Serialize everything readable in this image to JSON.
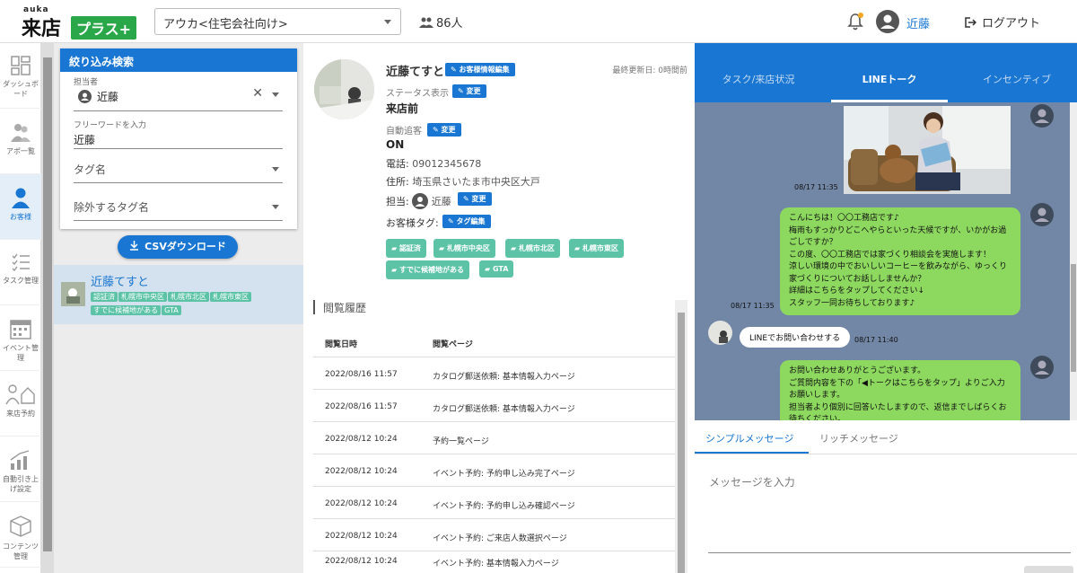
{
  "header": {
    "logo_small": "auka",
    "logo_main": "来店",
    "logo_plus": "プラス+",
    "org_select": "アウカ<住宅会社向け>",
    "member_count": "86人",
    "user_name": "近藤",
    "logout_label": "ログアウト"
  },
  "sidebar": {
    "items": [
      {
        "label": "ダッシュボード"
      },
      {
        "label": "アポ一覧"
      },
      {
        "label": "お客様"
      },
      {
        "label": "タスク管理"
      },
      {
        "label": "イベント管理"
      },
      {
        "label": "来店予約"
      },
      {
        "label": "自動引き上げ設定"
      },
      {
        "label": "コンテンツ管理"
      }
    ]
  },
  "filter": {
    "title": "絞り込み検索",
    "assignee_label": "担当者",
    "assignee_value": "近藤",
    "freeword_label": "フリーワードを入力",
    "freeword_value": "近藤",
    "tag_placeholder": "タグ名",
    "exclude_tag_placeholder": "除外するタグ名",
    "csv_button": "CSVダウンロード"
  },
  "customer_list": [
    {
      "name": "近藤てすと",
      "tags": [
        "認証済",
        "札幌市中央区",
        "札幌市北区",
        "札幌市東区",
        "すでに候補地がある",
        "GTA"
      ]
    }
  ],
  "detail": {
    "name": "近藤てすと",
    "edit_button": "お客様情報編集",
    "updated": "最終更新日: 0時間前",
    "status_label": "ステータス表示",
    "change_button": "変更",
    "status_value": "来店前",
    "auto_follow_label": "自動追客",
    "auto_follow_value": "ON",
    "phone_label": "電話:",
    "phone": "09012345678",
    "address_label": "住所:",
    "address": "埼玉県さいたま市中央区大戸",
    "assignee_label": "担当:",
    "assignee": "近藤",
    "tag_label": "お客様タグ:",
    "tag_edit_button": "タグ編集",
    "tags": [
      "認証済",
      "札幌市中央区",
      "札幌市北区",
      "札幌市東区",
      "すでに候補地がある",
      "GTA"
    ]
  },
  "history": {
    "title": "閲覧履歴",
    "col_date": "閲覧日時",
    "col_page": "閲覧ページ",
    "rows": [
      {
        "date": "2022/08/16 11:57",
        "page": "カタログ郵送依頼: 基本情報入力ページ"
      },
      {
        "date": "2022/08/16 11:57",
        "page": "カタログ郵送依頼: 基本情報入力ページ"
      },
      {
        "date": "2022/08/12 10:24",
        "page": "予約一覧ページ"
      },
      {
        "date": "2022/08/12 10:24",
        "page": "イベント予約: 予約申し込み完了ページ"
      },
      {
        "date": "2022/08/12 10:24",
        "page": "イベント予約: 予約申し込み確認ページ"
      },
      {
        "date": "2022/08/12 10:24",
        "page": "イベント予約: ご来店人数選択ページ"
      },
      {
        "date": "2022/08/12 10:24",
        "page": "イベント予約: 基本情報入力ページ"
      }
    ]
  },
  "right_tabs": [
    "タスク/来店状況",
    "LINEトーク",
    "インセンティブ"
  ],
  "chat": {
    "ts1": "08/17 11:35",
    "msg1": "こんにちは！〇〇工務店です♪\n梅雨もすっかりどこへやらといった天候ですが、いかがお過ごしですか？\nこの度、〇〇工務店では家づくり相談会を実施します！\n涼しい環境の中でおいしいコーヒーを飲みながら、ゆっくり家づくりについてお話ししませんか？\n詳細はこちらをタップしてください↓\nスタッフ一同お待ちしております♪",
    "ts2": "08/17 11:35",
    "user_msg": "LINEでお問い合わせする",
    "ts3": "08/17 11:40",
    "msg2": "お問い合わせありがとうございます。\nご質問内容を下の「◀トークはこちらをタップ」よりご入力お願いします。\n担当者より個別に回答いたしますので、返信までしばらくお待ちください。"
  },
  "message": {
    "tab_simple": "シンプルメッセージ",
    "tab_rich": "リッチメッセージ",
    "placeholder": "メッセージを入力"
  },
  "colors": {
    "primary": "#1976d2",
    "tag_green": "#5cc3a7",
    "line_green": "#8dd85f",
    "chat_bg": "#7287a6",
    "plus_green": "#2aa748"
  }
}
